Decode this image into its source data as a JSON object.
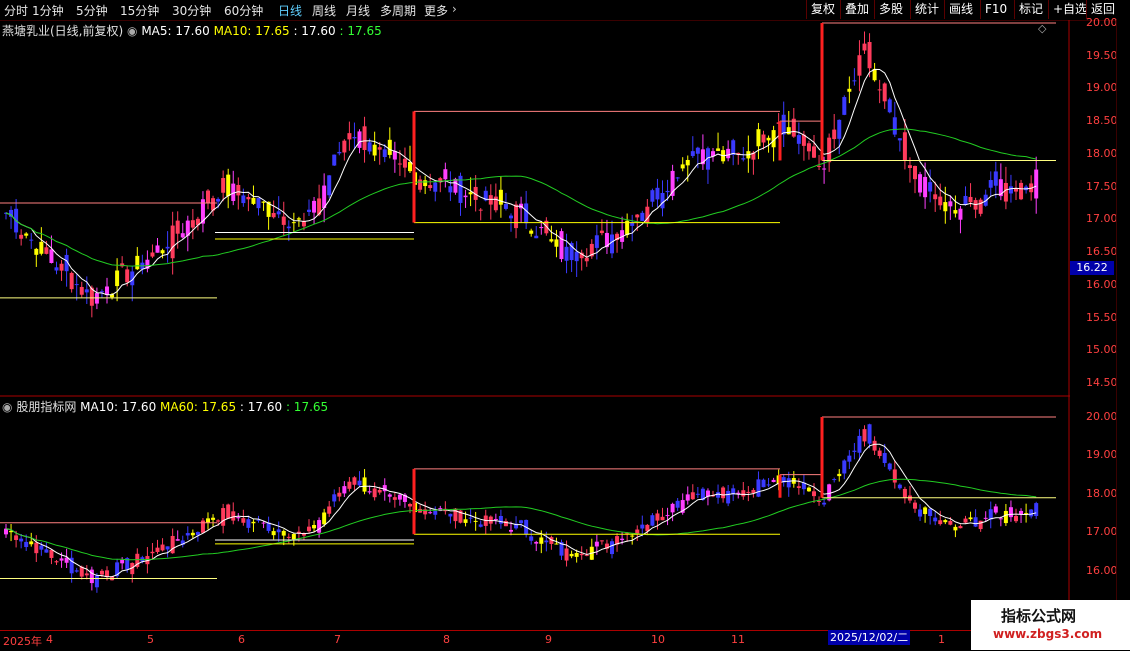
{
  "toolbar": {
    "timeframes": [
      "分时",
      "1分钟",
      "5分钟",
      "15分钟",
      "30分钟",
      "60分钟",
      "日线",
      "周线",
      "月线",
      "多周期",
      "更多"
    ],
    "active": "日线",
    "right_buttons": [
      "复权",
      "叠加",
      "多股",
      "统计",
      "画线",
      "F10",
      "标记",
      "+自选",
      "返回"
    ]
  },
  "main_panel": {
    "stock_name": "燕塘乳业(日线,前复权)",
    "ma5_label": "MA5: 17.60",
    "ma10_label": "MA10: 17.65",
    "extra1": ": 17.60",
    "extra2": ": 17.65",
    "price_tag": "16.22",
    "axis_ticks": [
      "20.00",
      "19.50",
      "19.00",
      "18.50",
      "18.00",
      "17.50",
      "17.00",
      "16.50",
      "16.00",
      "15.50",
      "15.00",
      "14.50"
    ]
  },
  "sub_panel": {
    "name": "股朋指标网",
    "ma10_label": "MA10: 17.60",
    "ma60_label": "MA60: 17.65",
    "extra1": ": 17.60",
    "extra2": ": 17.65",
    "axis_ticks": [
      "20.00",
      "19.00",
      "18.00",
      "17.00",
      "16.00"
    ]
  },
  "date_axis": {
    "labels": [
      "2025年",
      "4",
      "5",
      "6",
      "7",
      "8",
      "9",
      "10",
      "11",
      "1"
    ],
    "cursor_date": "2025/12/02/二"
  },
  "watermark": {
    "title": "指标公式网",
    "url": "www.zbgs3.com"
  },
  "colors": {
    "up": "#ff3b5c",
    "down": "#3a3aff",
    "yellow": "#ffff00",
    "magenta": "#ff40ff",
    "ma_white": "#ffffff",
    "ma_green": "#22cc22",
    "grid": "#aa0000"
  },
  "chart_data": {
    "type": "candlestick",
    "ylim_main": [
      14.5,
      20.0
    ],
    "ylim_sub": [
      15.5,
      20.0
    ],
    "x": [
      "4月",
      "5月",
      "6月",
      "7月",
      "8月",
      "9月",
      "10月",
      "11月",
      "12月",
      "1月"
    ],
    "close": [
      17.1,
      16.4,
      15.8,
      16.25,
      16.8,
      17.5,
      17.2,
      16.9,
      18.4,
      17.8,
      17.6,
      17.3,
      17.1,
      16.45,
      16.7,
      17.3,
      18.05,
      17.9,
      18.55,
      17.8,
      19.55,
      17.75,
      17.1,
      17.45,
      17.6
    ]
  }
}
